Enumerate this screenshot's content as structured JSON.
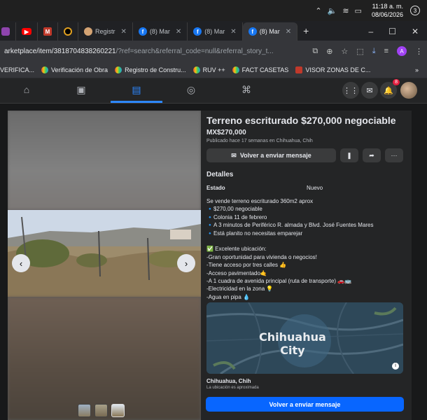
{
  "taskbar": {
    "time": "11:18 a. m.",
    "date": "08/06/2026",
    "notifications": "3"
  },
  "tabs": [
    {
      "label": "",
      "icon": "puzzle-purple-icon"
    },
    {
      "label": "",
      "icon": "youtube-icon"
    },
    {
      "label": "",
      "icon": "m-logo-icon"
    },
    {
      "label": "",
      "icon": "circle-icon"
    },
    {
      "label": "Registr",
      "icon": "registro-icon"
    },
    {
      "label": "(8) Mar",
      "icon": "facebook-icon"
    },
    {
      "label": "(8) Mar",
      "icon": "facebook-icon"
    },
    {
      "label": "(8) Mar",
      "icon": "facebook-icon",
      "active": true
    }
  ],
  "address": {
    "url_domain": "arketplace/item/3818704838260221",
    "url_rest": "/?ref=search&referral_code=null&referral_story_t..."
  },
  "bookmarks": [
    "VERIFICA...",
    "Verificación de Obra",
    "Registro de Constru...",
    "RUV ++",
    "FACT CASETAS",
    "VISOR ZONAS DE C..."
  ],
  "fb": {
    "notifications_count": "8"
  },
  "listing": {
    "title": "Terreno escriturado $270,000 negociable",
    "price": "MX$270,000",
    "posted": "Publicado hace 17 semanas en Chihuahua, Chih",
    "send_message": "Volver a enviar mensaje",
    "details_heading": "Detalles",
    "condition_label": "Estado",
    "condition_value": "Nuevo",
    "description": "Se vende terreno escriturado 360m2 aprox\n🔹$270,00 negociable\n🔹Colonia 11 de febrero\n🔹A 3 minutos de Periférico R. almada y Blvd. José Fuentes Mares\n🔹Está planito no necesitas emparejar\n\n✅ Excelente ubicación:\n-Gran oportunidad para vivienda o negocios!\n  -Tiene acceso por tres calles 👍\n  -Acceso pavimentado🤙\n  -A 1 cuadra de avenida principal (ruta de    transporte) 🚗🚌\n  -Electricidad en la zona 💡\n  -Agua en pipa 💧",
    "map_city_line1": "Chihuahua",
    "map_city_line2": "City",
    "location": "Chihuahua, Chih",
    "location_note": "La ubicación es aproximada",
    "send_message_bottom": "Volver a enviar mensaje"
  },
  "colors": {
    "fb_blue": "#0866ff",
    "active_nav": "#2d88ff",
    "background": "#18191a",
    "panel": "#242526"
  }
}
